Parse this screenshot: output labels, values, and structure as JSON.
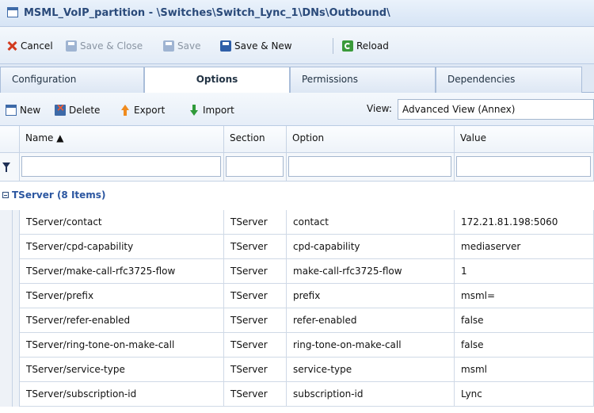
{
  "window": {
    "title": "MSML_VoIP_partition - \\Switches\\Switch_Lync_1\\DNs\\Outbound\\"
  },
  "toolbar": {
    "cancel": "Cancel",
    "save_close": "Save & Close",
    "save": "Save",
    "save_new": "Save & New",
    "reload": "Reload"
  },
  "tabs": [
    {
      "label": "Configuration"
    },
    {
      "label": "Options"
    },
    {
      "label": "Permissions"
    },
    {
      "label": "Dependencies"
    }
  ],
  "options_toolbar": {
    "new": "New",
    "delete": "Delete",
    "export": "Export",
    "import": "Import",
    "view_label": "View:",
    "view_value": "Advanced View (Annex)"
  },
  "grid": {
    "columns": {
      "name": "Name ▲",
      "section": "Section",
      "option": "Option",
      "value": "Value"
    },
    "group_label": "TServer (8 Items)",
    "rows": [
      {
        "name": "TServer/contact",
        "section": "TServer",
        "option": "contact",
        "value": "172.21.81.198:5060"
      },
      {
        "name": "TServer/cpd-capability",
        "section": "TServer",
        "option": "cpd-capability",
        "value": "mediaserver"
      },
      {
        "name": "TServer/make-call-rfc3725-flow",
        "section": "TServer",
        "option": "make-call-rfc3725-flow",
        "value": "1"
      },
      {
        "name": "TServer/prefix",
        "section": "TServer",
        "option": "prefix",
        "value": "msml="
      },
      {
        "name": "TServer/refer-enabled",
        "section": "TServer",
        "option": "refer-enabled",
        "value": "false"
      },
      {
        "name": "TServer/ring-tone-on-make-call",
        "section": "TServer",
        "option": "ring-tone-on-make-call",
        "value": "false"
      },
      {
        "name": "TServer/service-type",
        "section": "TServer",
        "option": "service-type",
        "value": "msml"
      },
      {
        "name": "TServer/subscription-id",
        "section": "TServer",
        "option": "subscription-id",
        "value": "Lync"
      }
    ]
  }
}
